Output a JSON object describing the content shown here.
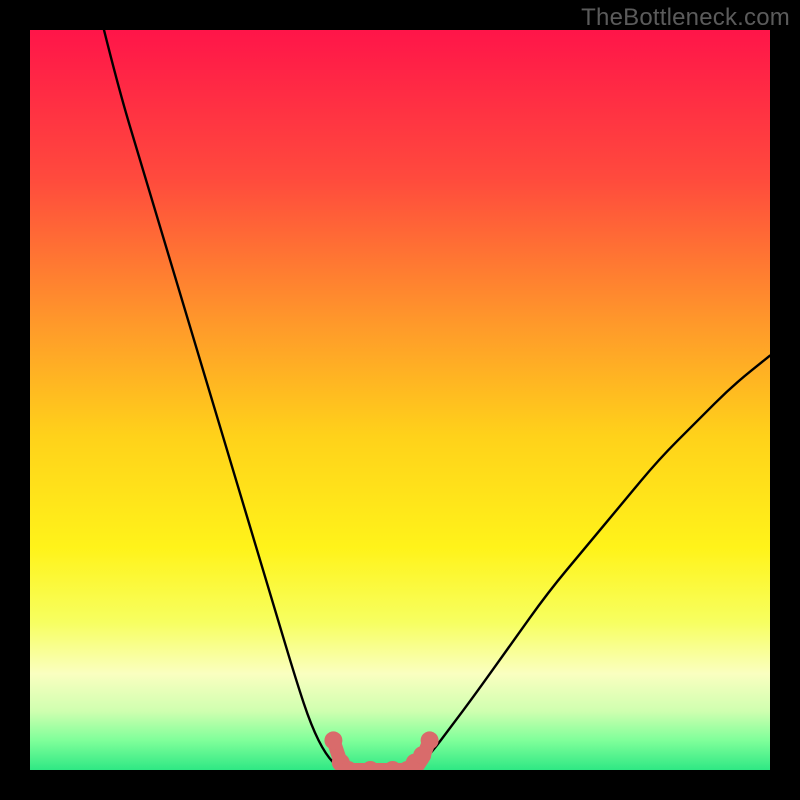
{
  "watermark": "TheBottleneck.com",
  "chart_data": {
    "type": "line",
    "title": "",
    "xlabel": "",
    "ylabel": "",
    "xlim": [
      0,
      100
    ],
    "ylim": [
      0,
      100
    ],
    "grid": false,
    "legend": false,
    "series": [
      {
        "name": "curve-left",
        "x": [
          10,
          12,
          15,
          18,
          21,
          24,
          27,
          30,
          33,
          36,
          38,
          40,
          42
        ],
        "values": [
          100,
          92,
          82,
          72,
          62,
          52,
          42,
          32,
          22,
          12,
          6,
          2,
          0
        ]
      },
      {
        "name": "curve-right",
        "x": [
          52,
          54,
          57,
          60,
          65,
          70,
          75,
          80,
          85,
          90,
          95,
          100
        ],
        "values": [
          0,
          2,
          6,
          10,
          17,
          24,
          30,
          36,
          42,
          47,
          52,
          56
        ]
      },
      {
        "name": "flat-bottom",
        "x": [
          42,
          44,
          46,
          48,
          50,
          52
        ],
        "values": [
          0,
          0,
          0,
          0,
          0,
          0
        ]
      }
    ],
    "markers": [
      {
        "name": "pink-marker",
        "x": 41,
        "y": 4
      },
      {
        "name": "pink-marker",
        "x": 42,
        "y": 1
      },
      {
        "name": "pink-marker",
        "x": 43,
        "y": 0
      },
      {
        "name": "pink-marker",
        "x": 46,
        "y": 0
      },
      {
        "name": "pink-marker",
        "x": 49,
        "y": 0
      },
      {
        "name": "pink-marker",
        "x": 51,
        "y": 0
      },
      {
        "name": "pink-marker",
        "x": 52,
        "y": 1
      },
      {
        "name": "pink-marker",
        "x": 53,
        "y": 2
      },
      {
        "name": "pink-marker",
        "x": 54,
        "y": 4
      }
    ],
    "gradient_stops": [
      {
        "offset": 0.0,
        "color": "#ff1549"
      },
      {
        "offset": 0.2,
        "color": "#ff4a3d"
      },
      {
        "offset": 0.4,
        "color": "#ff9a2a"
      },
      {
        "offset": 0.55,
        "color": "#ffd21a"
      },
      {
        "offset": 0.7,
        "color": "#fff31a"
      },
      {
        "offset": 0.8,
        "color": "#f7ff60"
      },
      {
        "offset": 0.87,
        "color": "#faffc0"
      },
      {
        "offset": 0.92,
        "color": "#d0ffb0"
      },
      {
        "offset": 0.96,
        "color": "#7fff9a"
      },
      {
        "offset": 1.0,
        "color": "#2fe884"
      }
    ],
    "marker_color": "#d96b6b",
    "curve_color": "#000000"
  }
}
